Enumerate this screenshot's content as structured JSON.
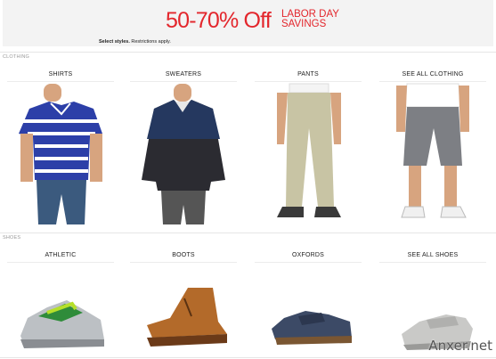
{
  "banner": {
    "headline": "50-70% Off",
    "subtitle_line1": "LABOR DAY",
    "subtitle_line2": "SAVINGS",
    "fine_bold": "Select styles.",
    "fine_text": "Restrictions apply.",
    "accent_color": "#e3262c"
  },
  "sections": {
    "clothing": {
      "label": "CLOTHING",
      "items": [
        {
          "label": "SHIRTS"
        },
        {
          "label": "SWEATERS"
        },
        {
          "label": "PANTS"
        },
        {
          "label": "SEE ALL CLOTHING"
        }
      ]
    },
    "shoes": {
      "label": "SHOES",
      "items": [
        {
          "label": "ATHLETIC"
        },
        {
          "label": "BOOTS"
        },
        {
          "label": "OXFORDS"
        },
        {
          "label": "SEE ALL SHOES"
        }
      ]
    }
  },
  "watermark": "Anxer.net"
}
